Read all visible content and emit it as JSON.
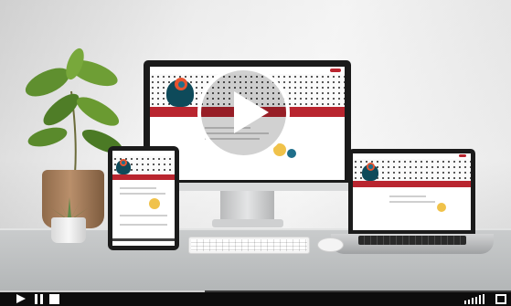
{
  "player": {
    "progress": 0.4,
    "volume_levels": 6,
    "controls": [
      "play",
      "pause",
      "stop",
      "volume",
      "fullscreen"
    ]
  },
  "icons": {
    "play": "play-icon",
    "pause": "pause-icon",
    "stop": "stop-icon",
    "volume": "volume-icon",
    "fullscreen": "fullscreen-icon"
  },
  "colors": {
    "bar_background": "#0d0d0d",
    "accent_red": "#b9252f"
  }
}
